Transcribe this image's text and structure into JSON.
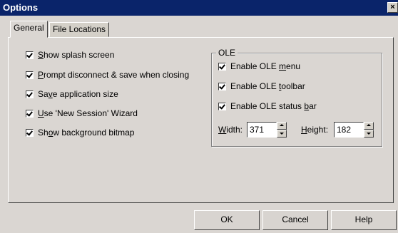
{
  "window": {
    "title": "Options",
    "close_glyph": "×"
  },
  "tabs": [
    {
      "label": "General"
    },
    {
      "label": "File Locations"
    }
  ],
  "general": {
    "options": [
      {
        "pre": "",
        "key": "S",
        "post": "how splash screen",
        "checked": true
      },
      {
        "pre": "",
        "key": "P",
        "post": "rompt disconnect & save when closing",
        "checked": true
      },
      {
        "pre": "Sa",
        "key": "v",
        "post": "e application size",
        "checked": true
      },
      {
        "pre": "",
        "key": "U",
        "post": "se 'New Session' Wizard",
        "checked": true
      },
      {
        "pre": "Sh",
        "key": "o",
        "post": "w background bitmap",
        "checked": true
      }
    ]
  },
  "ole": {
    "group_label": "OLE",
    "options": [
      {
        "pre": "Enable OLE ",
        "key": "m",
        "post": "enu",
        "checked": true
      },
      {
        "pre": "Enable OLE ",
        "key": "t",
        "post": "oolbar",
        "checked": true
      },
      {
        "pre": "Enable OLE status ",
        "key": "b",
        "post": "ar",
        "checked": true
      }
    ],
    "width": {
      "pre": "",
      "key": "W",
      "post": "idth:",
      "value": "371"
    },
    "height": {
      "pre": "",
      "key": "H",
      "post": "eight:",
      "value": "182"
    }
  },
  "buttons": {
    "ok": "OK",
    "cancel": "Cancel",
    "help": "Help"
  }
}
